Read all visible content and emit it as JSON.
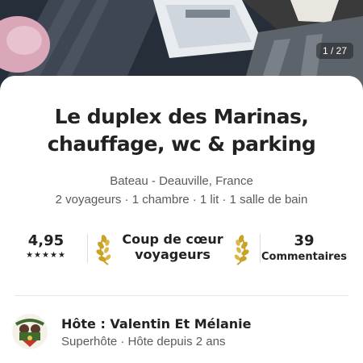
{
  "gallery": {
    "counter": "1 / 27"
  },
  "listing": {
    "title_line1": "Le duplex des Marinas,",
    "title_line2": "chauffage, wc & parking",
    "location": "Bateau - Deauville, France",
    "details": "2 voyageurs · 1 chambre · 1 lit · 1 salle de bain"
  },
  "stats": {
    "rating": "4,95",
    "stars": 5,
    "stars_text": "★★★★★",
    "badge_line1": "Coup de cœur",
    "badge_line2": "voyageurs",
    "reviews_count": "39",
    "reviews_label": "Commentaires"
  },
  "host": {
    "name": "Hôte : Valentin Et Mélanie",
    "meta": "Superhôte · Hôte depuis 2 ans",
    "avatar_icon": "host-avatar-icon"
  },
  "colors": {
    "text": "#222222",
    "muted": "#5a5a5a",
    "laurel_gold": "#c9a227",
    "divider": "#dddddd"
  }
}
